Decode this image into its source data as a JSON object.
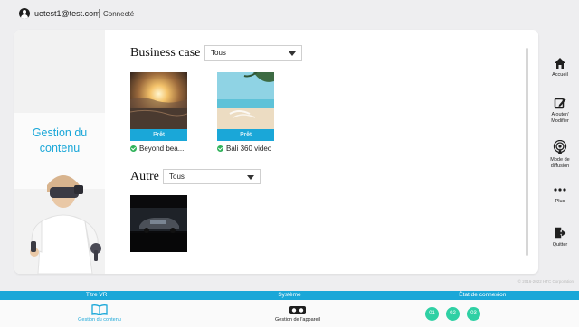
{
  "user": {
    "email": "uetest1@test.com",
    "status": "Connecté"
  },
  "banner": {
    "title": "Gestion du\ncontenu"
  },
  "sections": [
    {
      "title": "Business case",
      "filter": "Tous",
      "items": [
        {
          "badge": "Prêt",
          "caption": "Beyond bea..."
        },
        {
          "badge": "Prêt",
          "caption": "Bali 360 video"
        }
      ]
    },
    {
      "title": "Autre",
      "filter": "Tous",
      "items": [
        {
          "badge": "",
          "caption": ""
        }
      ]
    }
  ],
  "rightnav": [
    {
      "label": "Accueil",
      "icon": "home-icon"
    },
    {
      "label": "Ajouter/\nModifier",
      "icon": "edit-icon"
    },
    {
      "label": "Mode de\ndiffusion",
      "icon": "broadcast-icon"
    },
    {
      "label": "Plus",
      "icon": "more-icon"
    },
    {
      "label": "Quitter",
      "icon": "logout-icon"
    }
  ],
  "copyright": "© 2016-2022 HTC Corporation",
  "bottom_bar": {
    "col1": "Titre VR",
    "col2": "Système",
    "col3": "État de connexion"
  },
  "bottom": {
    "content_label": "Gestion du contenu",
    "device_label": "Gestion de l'appareil",
    "devices": [
      "01",
      "02",
      "03"
    ]
  },
  "colors": {
    "accent": "#1aa7d8",
    "ok": "#2fb25a",
    "device": "#2fd0a4"
  }
}
